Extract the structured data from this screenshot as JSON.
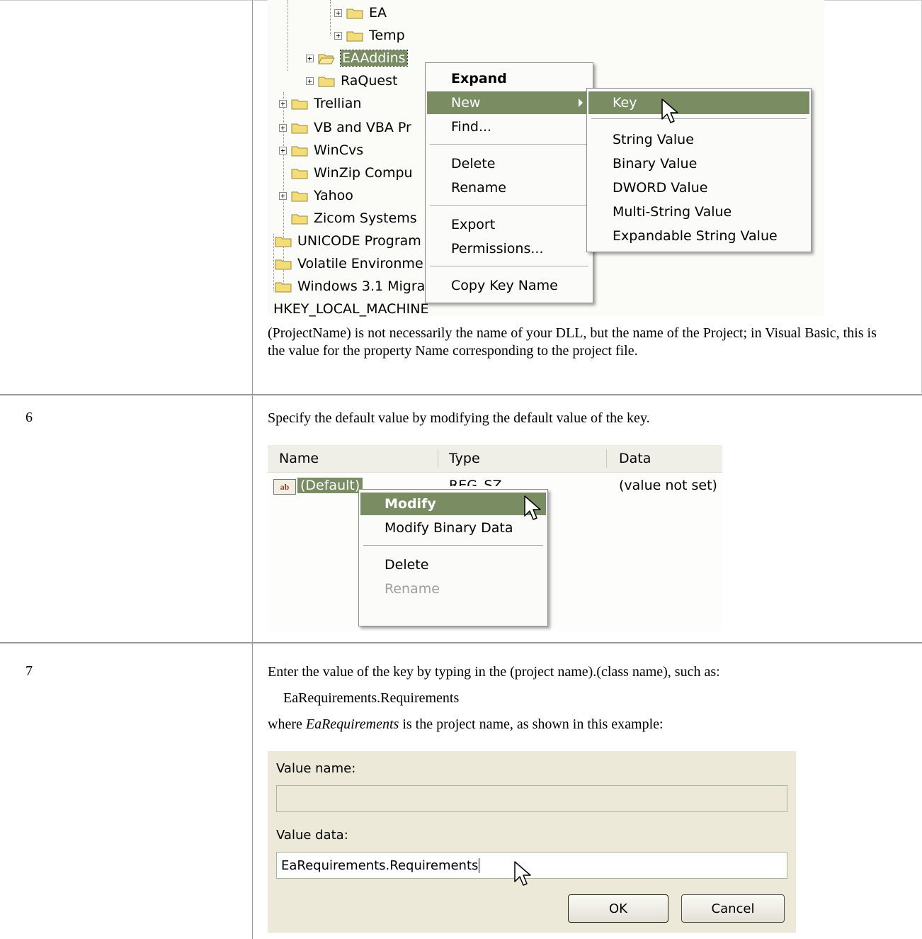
{
  "row5": {
    "tree": {
      "items": [
        "EA",
        "Temp",
        "EAAddins",
        "RaQuest",
        "Trellian",
        "VB and VBA Pr",
        "WinCvs",
        "WinZip Compu",
        "Yahoo",
        "Zicom Systems",
        "UNICODE Program",
        "Volatile Environme",
        "Windows 3.1 Migra"
      ],
      "footer": "HKEY_LOCAL_MACHINE"
    },
    "context_menu": {
      "items": [
        "Expand",
        "New",
        "Find...",
        "Delete",
        "Rename",
        "Export",
        "Permissions...",
        "Copy Key Name"
      ]
    },
    "new_submenu": {
      "items": [
        "Key",
        "String Value",
        "Binary Value",
        "DWORD Value",
        "Multi-String Value",
        "Expandable String Value"
      ]
    },
    "note": "(ProjectName) is not necessarily the name of your DLL, but the name of the Project; in Visual Basic, this is the value for the property Name corresponding to the project file."
  },
  "row6": {
    "step": "6",
    "text": "Specify the default value by modifying the default value of the key.",
    "columns": [
      "Name",
      "Type",
      "Data"
    ],
    "value_row": {
      "icon": "ab",
      "name": "(Default)",
      "type": "REG_SZ",
      "data": "(value not set)"
    },
    "context_menu": {
      "items": [
        "Modify",
        "Modify Binary Data",
        "Delete",
        "Rename"
      ]
    }
  },
  "row7": {
    "step": "7",
    "text": "Enter the value of the key by typing in the (project name).(class name), such as:",
    "example": "EaRequirements.Requirements",
    "where_prefix": "where ",
    "where_term": "EaRequirements",
    "where_suffix": " is the project name, as shown in this example:",
    "dialog": {
      "value_name_label": "Value name:",
      "value_name": "",
      "value_data_label": "Value data:",
      "value_data": "EaRequirements.Requirements",
      "ok": "OK",
      "cancel": "Cancel"
    }
  },
  "colors": {
    "highlight": "#7a8c62",
    "border": "#9a9a9a",
    "dialog_bg": "#ece9d8"
  }
}
